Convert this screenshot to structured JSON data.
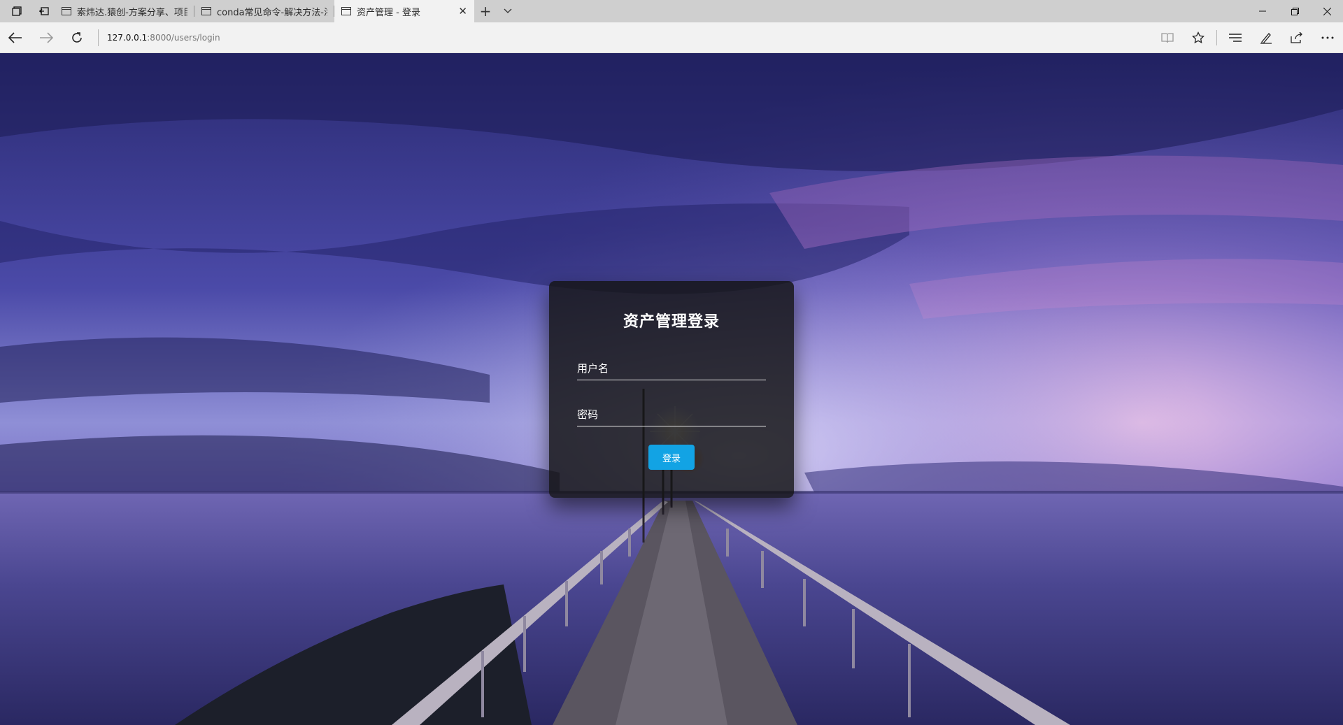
{
  "browser": {
    "tabs": [
      {
        "label": "索炜达.猿创-方案分享、项目",
        "active": false
      },
      {
        "label": "conda常见命令-解决方法-渗",
        "active": false
      },
      {
        "label": "资产管理 - 登录",
        "active": true
      }
    ],
    "url_host": "127.0.0.1",
    "url_path": ":8000/users/login",
    "icons": {
      "set_aside": "tabs-aside-icon",
      "restore_tabs": "restore-tabs-icon",
      "new_tab": "plus-icon",
      "tab_menu": "chevron-down-icon",
      "back": "arrow-left-icon",
      "forward": "arrow-right-icon",
      "refresh": "refresh-icon",
      "reading_view": "book-icon",
      "favorite": "star-icon",
      "hub": "hub-icon",
      "notes": "pen-icon",
      "share": "share-icon",
      "more": "more-icon",
      "minimize": "minimize-icon",
      "maximize": "restore-icon",
      "close": "close-icon"
    }
  },
  "login": {
    "title": "资产管理登录",
    "username_label": "用户名",
    "username_value": "",
    "password_label": "密码",
    "password_value": "",
    "submit_label": "登录"
  },
  "colors": {
    "button": "#12a3e4",
    "card_background": "#141416"
  }
}
